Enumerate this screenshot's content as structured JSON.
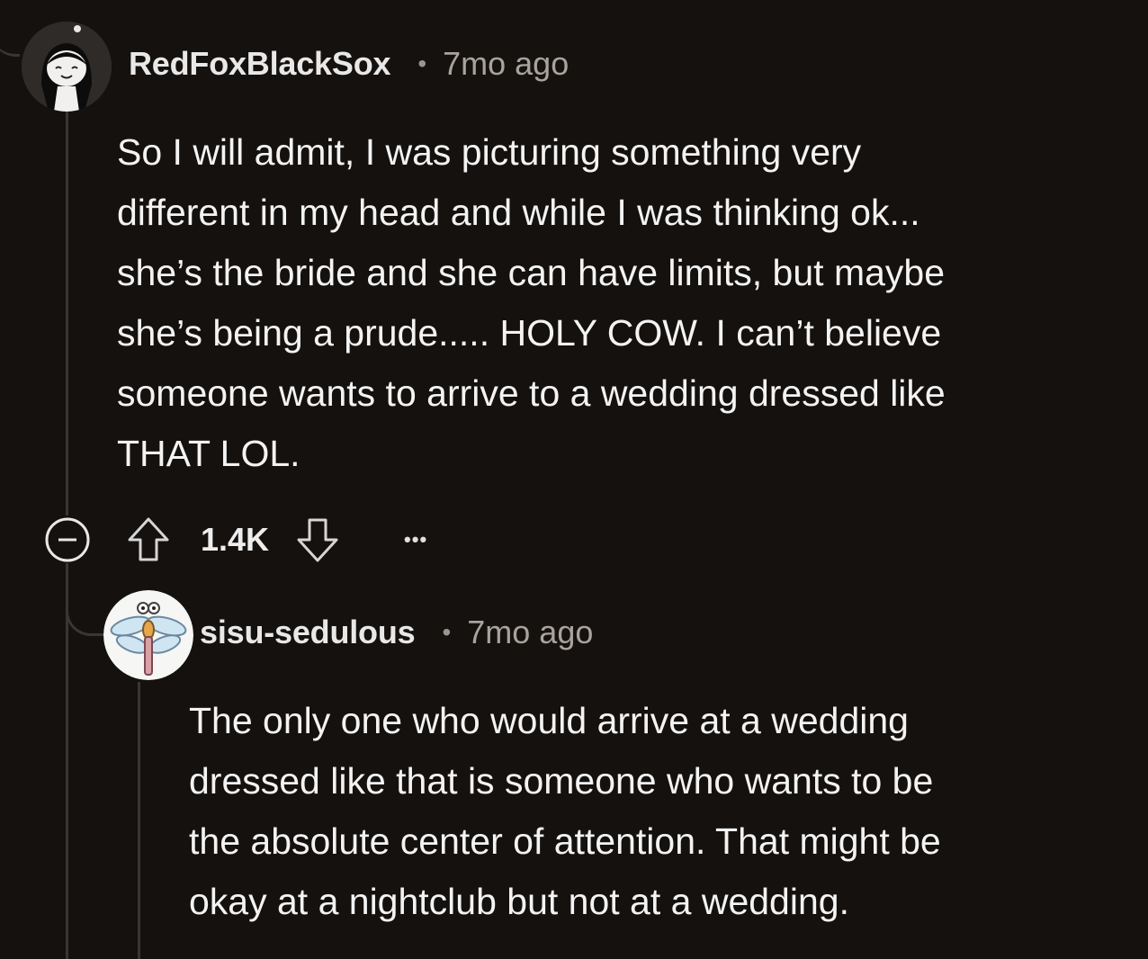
{
  "comments": [
    {
      "username": "RedFoxBlackSox",
      "separator": "•",
      "time": "7mo ago",
      "body": "So I will admit, I was picturing something very\ndifferent in my head and while I was thinking ok...\nshe’s the bride and she can have limits, but maybe\nshe’s being a prude..... HOLY COW. I can’t believe\nsomeone wants to arrive to a wedding dressed like\nTHAT LOL.",
      "score": "1.4K",
      "more": "•••",
      "avatar_icon": "cartoon-avatar-icon"
    },
    {
      "username": "sisu-sedulous",
      "separator": "•",
      "time": "7mo ago",
      "body": "The only one who would arrive at a wedding\ndressed like that is someone who wants to be\nthe absolute center of attention. That might be\nokay at a nightclub but not at a wedding.",
      "avatar_icon": "dragonfly-avatar-icon"
    }
  ],
  "colors": {
    "background": "#14110f",
    "thread_line": "#3a3633",
    "text": "#f3f3f3",
    "muted": "#a8a39d"
  }
}
